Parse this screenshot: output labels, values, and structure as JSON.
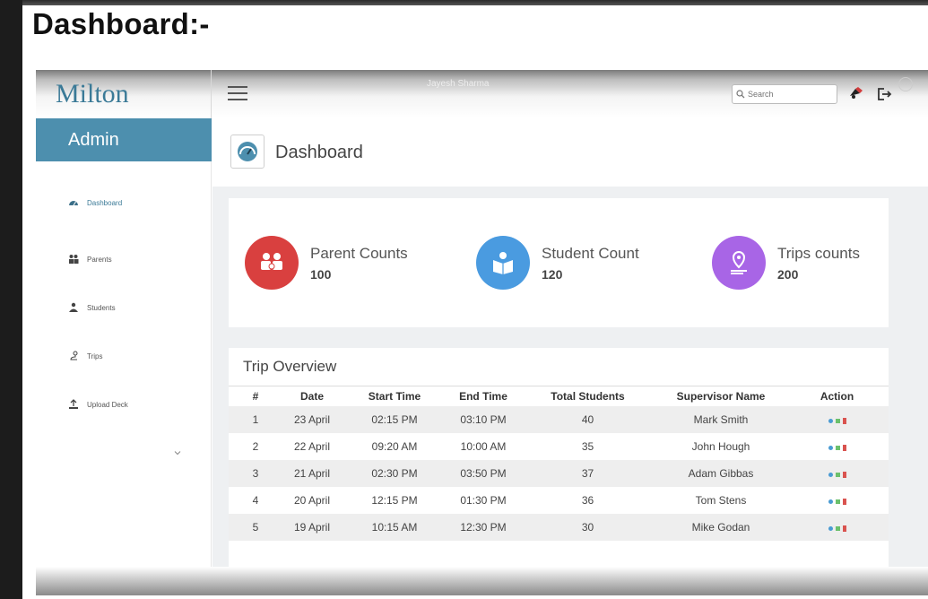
{
  "doc_heading": "Dashboard:-",
  "brand": "Milton",
  "topbar": {
    "user_name": "Jayesh Sharma",
    "search_placeholder": "Search",
    "icons": [
      "bell-icon",
      "logout-icon"
    ]
  },
  "sidebar": {
    "role": "Admin",
    "items": [
      {
        "label": "Dashboard",
        "icon": "speedometer-icon",
        "active": true
      },
      {
        "label": "Parents",
        "icon": "people-icon",
        "active": false
      },
      {
        "label": "Students",
        "icon": "student-icon",
        "active": false
      },
      {
        "label": "Trips",
        "icon": "route-icon",
        "active": false
      },
      {
        "label": "Upload Deck",
        "icon": "upload-icon",
        "active": false
      }
    ]
  },
  "page": {
    "title": "Dashboard"
  },
  "stats": [
    {
      "label": "Parent Counts",
      "value": "100",
      "color": "#d9403f",
      "icon": "parents-icon"
    },
    {
      "label": "Student Count",
      "value": "120",
      "color": "#4a9be0",
      "icon": "reading-student-icon"
    },
    {
      "label": "Trips counts",
      "value": "200",
      "color": "#a865e6",
      "icon": "map-pin-route-icon"
    }
  ],
  "trip_overview": {
    "title": "Trip Overview",
    "columns": [
      "#",
      "Date",
      "Start Time",
      "End Time",
      "Total Students",
      "Supervisor Name",
      "Action"
    ],
    "rows": [
      [
        "1",
        "23 April",
        "02:15 PM",
        "03:10 PM",
        "40",
        "Mark Smith"
      ],
      [
        "2",
        "22 April",
        "09:20 AM",
        "10:00 AM",
        "35",
        "John Hough"
      ],
      [
        "3",
        "21 April",
        "02:30 PM",
        "03:50 PM",
        "37",
        "Adam Gibbas"
      ],
      [
        "4",
        "20 April",
        "12:15 PM",
        "01:30 PM",
        "36",
        "Tom Stens"
      ],
      [
        "5",
        "19 April",
        "10:15 AM",
        "12:30 PM",
        "30",
        "Mike Godan"
      ]
    ]
  },
  "colors": {
    "accent": "#4d8fae",
    "brand_text": "#3b7a97",
    "action_view": "#4a9bd3",
    "action_edit": "#6cc06c",
    "action_delete": "#d9534f"
  }
}
